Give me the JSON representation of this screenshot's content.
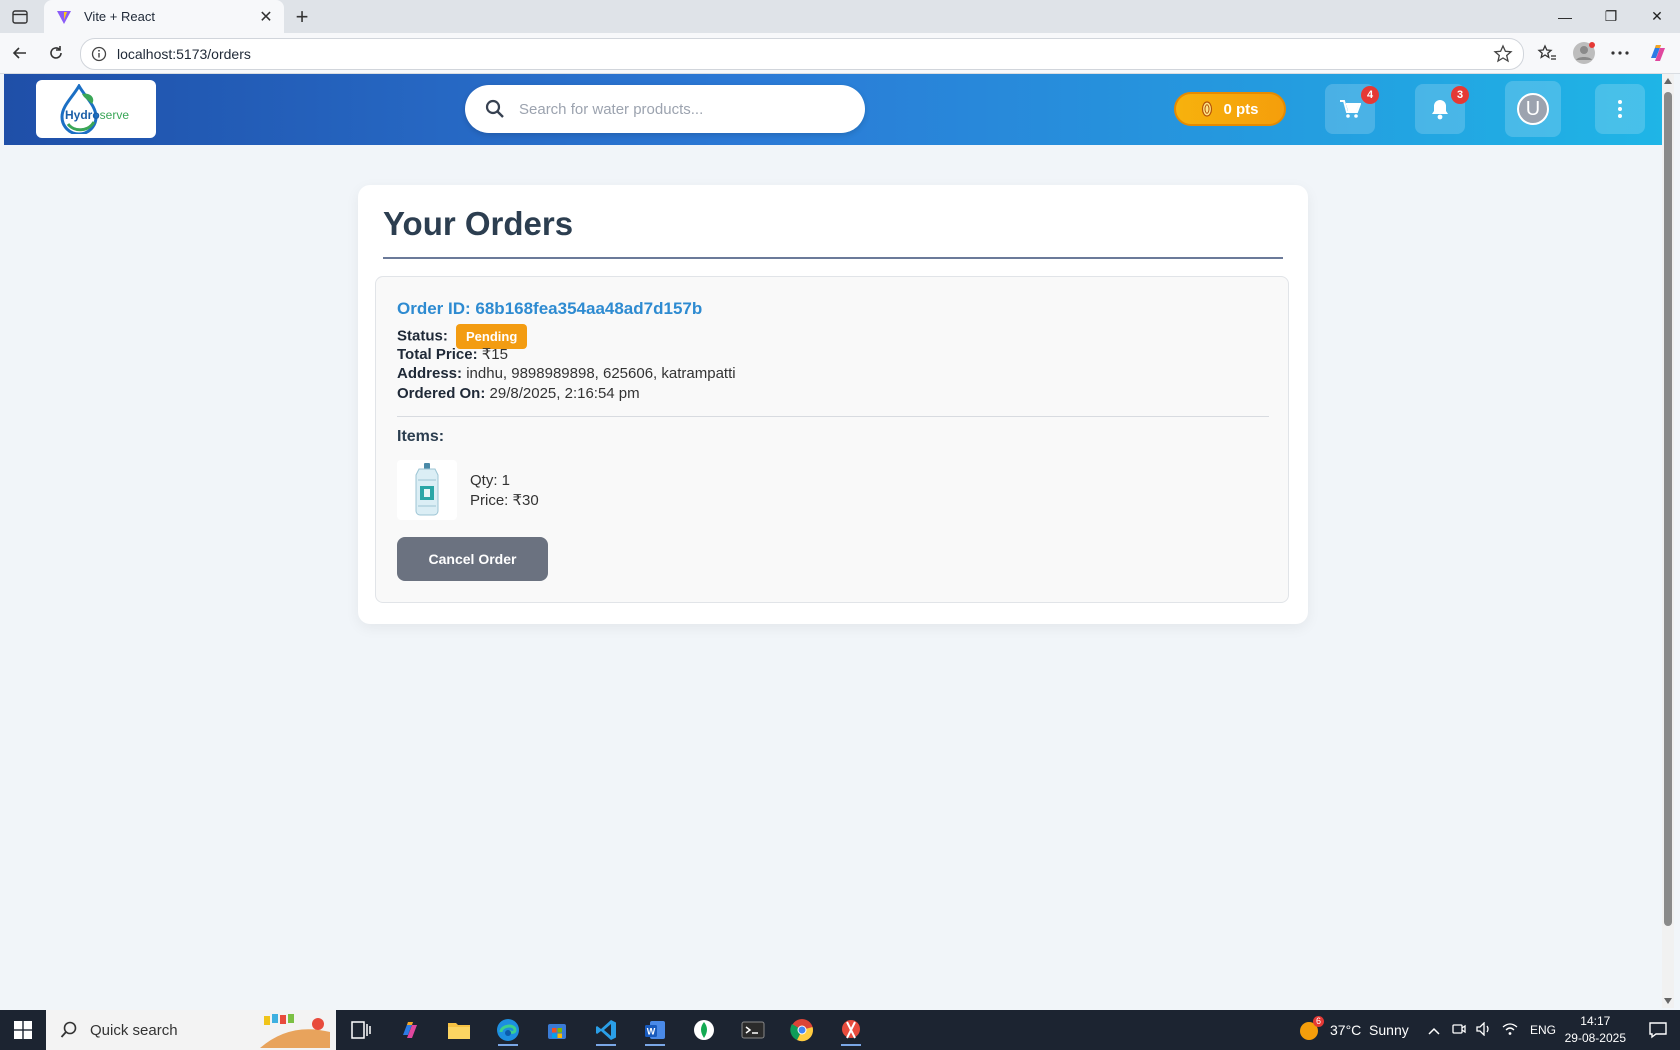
{
  "browser": {
    "tab_title": "Vite + React",
    "url": "localhost:5173/orders"
  },
  "navbar": {
    "logo_text_main": "Hydro",
    "logo_text_accent": "serve",
    "search_placeholder": "Search for water products...",
    "points_label": "0 pts",
    "cart_count": "4",
    "notification_count": "3",
    "avatar_initial": "U"
  },
  "orders": {
    "heading": "Your Orders",
    "list": [
      {
        "order_id": "Order ID: 68b168fea354aa48ad7d157b",
        "status_label": "Status:",
        "status_value": "Pending",
        "total_label": "Total Price:",
        "total_value": "₹15",
        "address_label": "Address:",
        "address_value": "indhu, 9898989898, 625606, katrampatti",
        "ordered_label": "Ordered On:",
        "ordered_value": "29/8/2025, 2:16:54 pm",
        "items_label": "Items:",
        "items": [
          {
            "qty": "Qty: 1",
            "price": "Price: ₹30"
          }
        ],
        "cancel_label": "Cancel Order"
      }
    ]
  },
  "taskbar": {
    "search_label": "Quick search",
    "weather": "37°C  Sunny",
    "weather_badge": "6",
    "language": "ENG",
    "time": "14:17",
    "date": "29-08-2025"
  },
  "colors": {
    "nav_gradient_start": "#1f4fa8",
    "nav_gradient_end": "#1fb5e6",
    "points_gold": "#f59e0b",
    "order_id_blue": "#2e8bd1",
    "status_pending": "#f39c12",
    "cancel_gray": "#6b7280",
    "badge_red": "#e53935"
  }
}
